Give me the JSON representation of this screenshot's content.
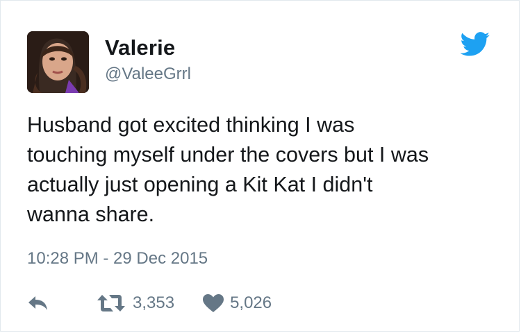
{
  "tweet": {
    "author": {
      "display_name": "Valerie",
      "handle": "@ValeeGrrl"
    },
    "text": "Husband got excited thinking I was\ntouching myself under the covers but I was\nactually just opening a Kit Kat I didn't\nwanna share.",
    "timestamp": "10:28 PM - 29 Dec 2015",
    "stats": {
      "retweets": "3,353",
      "likes": "5,026"
    }
  },
  "icons": {
    "brand": "twitter-bird-icon",
    "reply": "reply-icon",
    "retweet": "retweet-icon",
    "like": "heart-icon"
  },
  "colors": {
    "brand": "#1da1f2",
    "secondary_text": "#657786",
    "primary_text": "#14171a"
  }
}
